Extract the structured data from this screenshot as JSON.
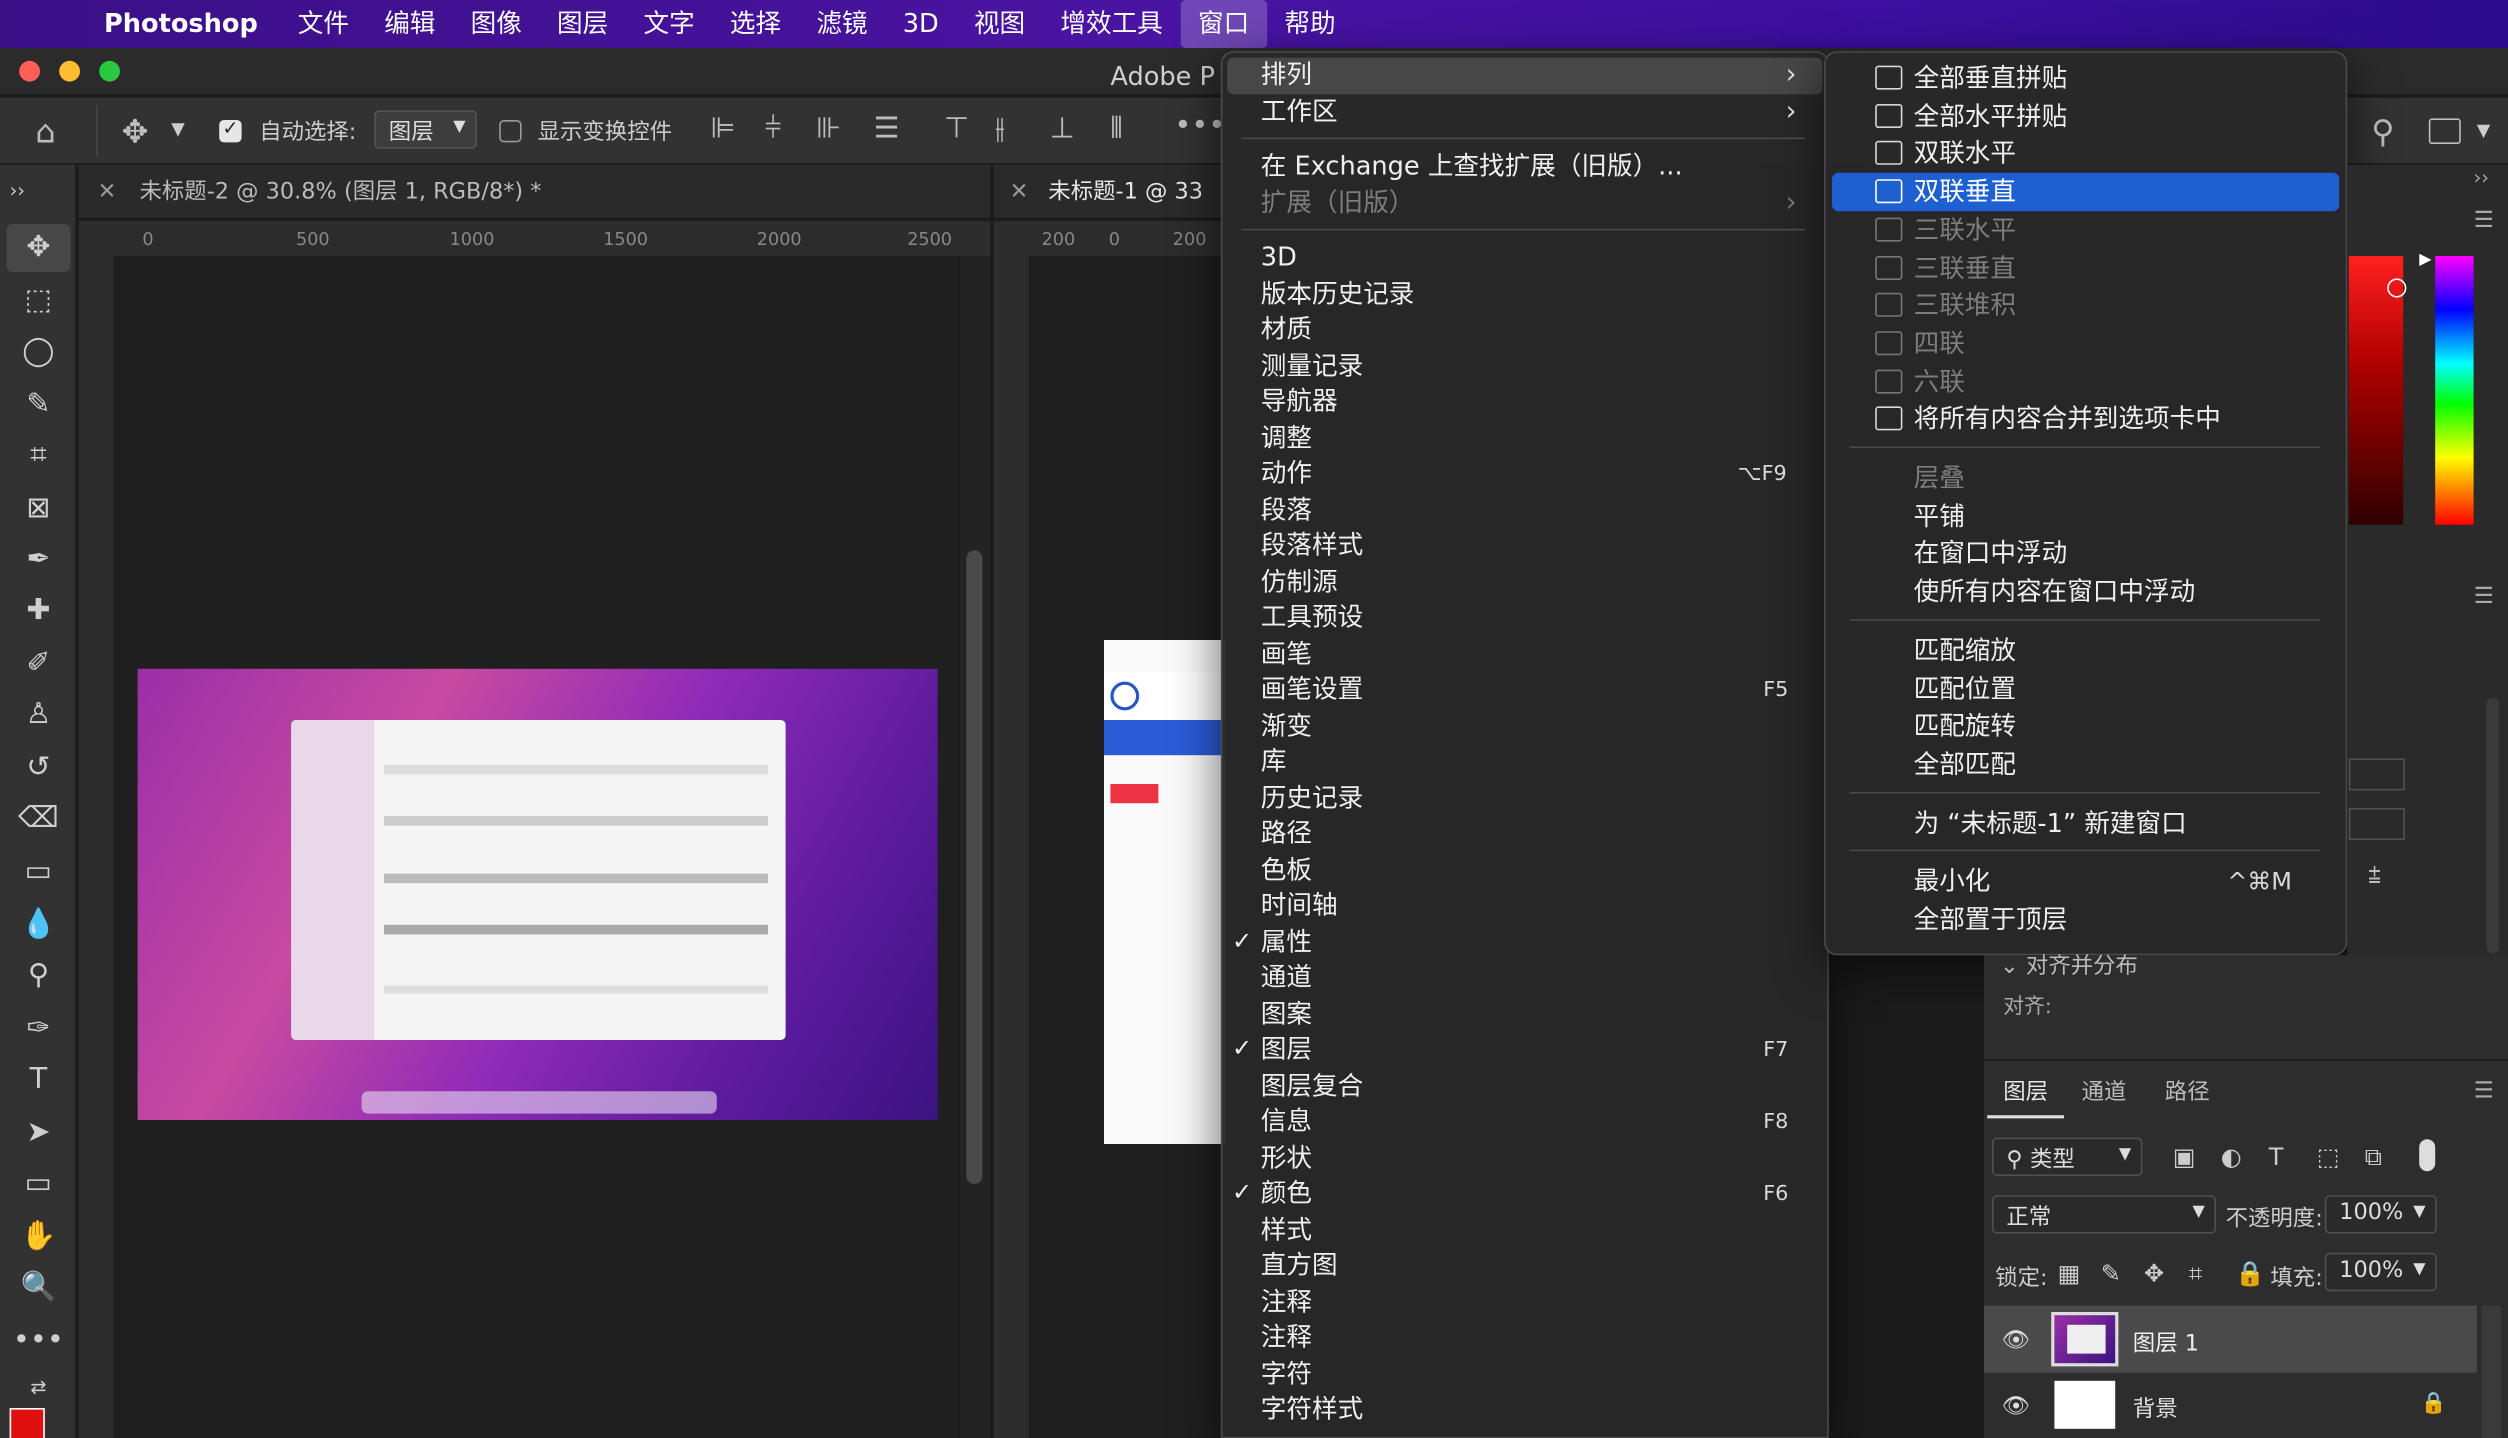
{
  "menubar": {
    "items": [
      "Photoshop",
      "文件",
      "编辑",
      "图像",
      "图层",
      "文字",
      "选择",
      "滤镜",
      "3D",
      "视图",
      "增效工具",
      "窗口",
      "帮助"
    ]
  },
  "app_title": "Adobe P",
  "options_bar": {
    "auto_select_label": "自动选择:",
    "layer_select_value": "图层",
    "show_transform_label": "显示变换控件"
  },
  "documents": [
    {
      "tab": "未标题-2 @ 30.8% (图层 1, RGB/8*) *",
      "ruler_ticks": [
        "0",
        "500",
        "1000",
        "1500",
        "2000",
        "2500"
      ]
    },
    {
      "tab": "未标题-1 @ 33",
      "ruler_ticks": [
        "200",
        "0",
        "200"
      ]
    }
  ],
  "window_menu": {
    "items": [
      {
        "label": "排列",
        "submenu": true
      },
      {
        "label": "工作区",
        "submenu": true
      },
      {
        "sep": true
      },
      {
        "label": "在 Exchange 上查找扩展（旧版）..."
      },
      {
        "label": "扩展（旧版）",
        "dim": true,
        "submenu": true
      },
      {
        "sep": true
      },
      {
        "label": "3D"
      },
      {
        "label": "版本历史记录"
      },
      {
        "label": "材质"
      },
      {
        "label": "测量记录"
      },
      {
        "label": "导航器"
      },
      {
        "label": "调整"
      },
      {
        "label": "动作",
        "shortcut": "⌥F9"
      },
      {
        "label": "段落"
      },
      {
        "label": "段落样式"
      },
      {
        "label": "仿制源"
      },
      {
        "label": "工具预设"
      },
      {
        "label": "画笔"
      },
      {
        "label": "画笔设置",
        "shortcut": "F5"
      },
      {
        "label": "渐变"
      },
      {
        "label": "库"
      },
      {
        "label": "历史记录"
      },
      {
        "label": "路径"
      },
      {
        "label": "色板"
      },
      {
        "label": "时间轴"
      },
      {
        "label": "属性",
        "checked": true
      },
      {
        "label": "通道"
      },
      {
        "label": "图案"
      },
      {
        "label": "图层",
        "checked": true,
        "shortcut": "F7"
      },
      {
        "label": "图层复合"
      },
      {
        "label": "信息",
        "shortcut": "F8"
      },
      {
        "label": "形状"
      },
      {
        "label": "颜色",
        "checked": true,
        "shortcut": "F6"
      },
      {
        "label": "样式"
      },
      {
        "label": "直方图"
      },
      {
        "label": "注释"
      },
      {
        "label": "注释"
      },
      {
        "label": "字符"
      },
      {
        "label": "字符样式"
      }
    ]
  },
  "arrange_submenu": {
    "items": [
      {
        "label": "全部垂直拼贴",
        "icon": "tile-vertical-icon"
      },
      {
        "label": "全部水平拼贴",
        "icon": "tile-horizontal-icon"
      },
      {
        "label": "双联水平",
        "icon": "2up-horizontal-icon"
      },
      {
        "label": "双联垂直",
        "icon": "2up-vertical-icon",
        "selected": true
      },
      {
        "label": "三联水平",
        "icon": "3up-horizontal-icon",
        "dim": true
      },
      {
        "label": "三联垂直",
        "icon": "3up-vertical-icon",
        "dim": true
      },
      {
        "label": "三联堆积",
        "icon": "3up-stacked-icon",
        "dim": true
      },
      {
        "label": "四联",
        "icon": "4up-icon",
        "dim": true
      },
      {
        "label": "六联",
        "icon": "6up-icon",
        "dim": true
      },
      {
        "label": "将所有内容合并到选项卡中",
        "icon": "consolidate-tabs-icon"
      },
      {
        "sep": true
      },
      {
        "label": "层叠",
        "dim": true
      },
      {
        "label": "平铺"
      },
      {
        "label": "在窗口中浮动"
      },
      {
        "label": "使所有内容在窗口中浮动"
      },
      {
        "sep": true
      },
      {
        "label": "匹配缩放"
      },
      {
        "label": "匹配位置"
      },
      {
        "label": "匹配旋转"
      },
      {
        "label": "全部匹配"
      },
      {
        "sep": true
      },
      {
        "label": "为 “未标题-1” 新建窗口"
      },
      {
        "sep": true
      },
      {
        "label": "最小化",
        "shortcut": "^⌘M"
      },
      {
        "label": "全部置于顶层"
      }
    ]
  },
  "right_panel": {
    "partial_text_1": "对齐并分布",
    "partial_text_2": "对齐:",
    "layers_tabs": [
      "图层",
      "通道",
      "路径"
    ],
    "filter_kind": "类型",
    "blend_mode": "正常",
    "opacity_label": "不透明度:",
    "opacity_value": "100%",
    "lock_label": "锁定:",
    "fill_label": "填充:",
    "fill_value": "100%",
    "layers": [
      {
        "name": "图层 1",
        "selected": true
      },
      {
        "name": "背景",
        "locked": true
      }
    ]
  },
  "colors": {
    "menubar": "#4a14a3",
    "selection": "#1e5fd1",
    "foreground_swatch": "#e01010"
  }
}
